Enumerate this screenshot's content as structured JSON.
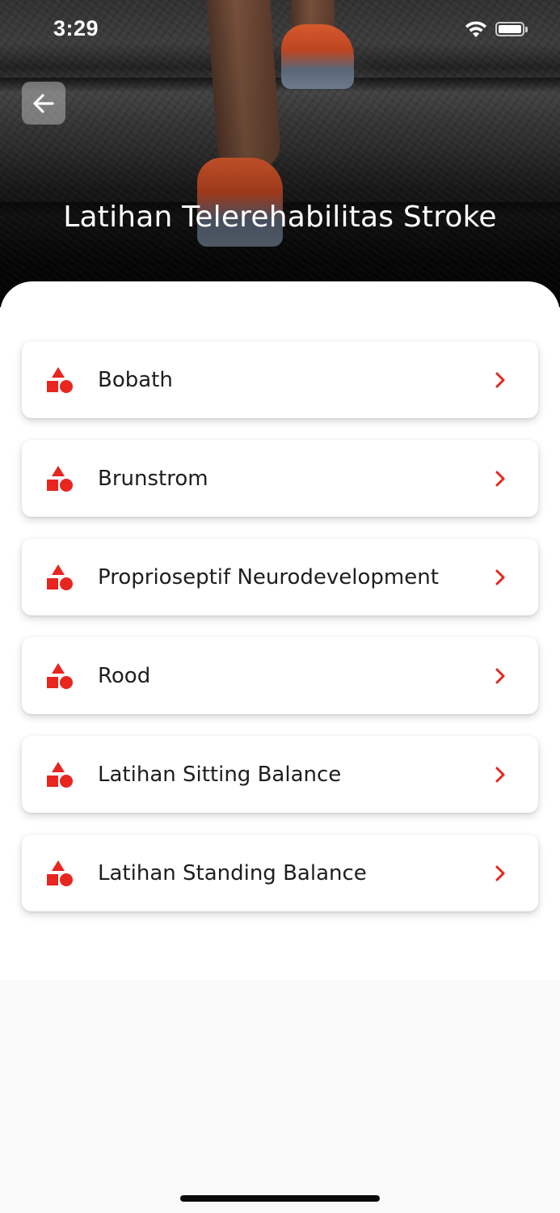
{
  "status_bar": {
    "time": "3:29"
  },
  "header": {
    "title": "Latihan Telerehabilitas Stroke",
    "back_icon": "arrow-left-icon"
  },
  "menu": {
    "item_icon": "shapes-icon",
    "chevron_icon": "chevron-right-icon",
    "items": [
      {
        "label": "Bobath"
      },
      {
        "label": "Brunstrom"
      },
      {
        "label": "Proprioseptif Neurodevelopment"
      },
      {
        "label": "Rood"
      },
      {
        "label": "Latihan Sitting Balance"
      },
      {
        "label": "Latihan Standing Balance"
      }
    ]
  },
  "colors": {
    "accent": "#e8251f",
    "card_background": "#ffffff",
    "page_background": "#f9f9f9",
    "text": "#1e1e1e"
  }
}
